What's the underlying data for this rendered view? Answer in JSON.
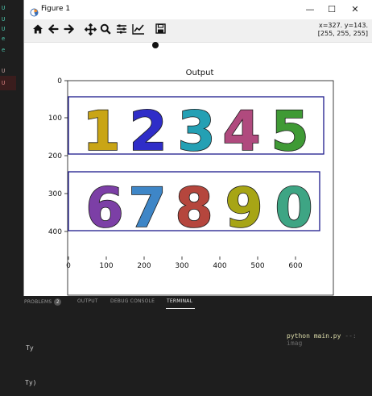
{
  "window": {
    "title": "Figure 1",
    "controls": {
      "minimize": "—",
      "maximize": "☐",
      "close": "✕"
    }
  },
  "toolbar": {
    "buttons": [
      "home-icon",
      "back-arrow-icon",
      "forward-arrow-icon",
      "pan-icon",
      "zoom-icon",
      "configure-subplots-icon",
      "edit-axis-icon",
      "save-icon"
    ],
    "coord_line1": "x=327. y=143.",
    "coord_line2": "[255, 255, 255]"
  },
  "plot": {
    "title": "Output",
    "x_ticks": [
      "0",
      "100",
      "200",
      "300",
      "400",
      "500",
      "600"
    ],
    "y_ticks": [
      "0",
      "100",
      "200",
      "300",
      "400"
    ],
    "digits_top": [
      "1",
      "2",
      "3",
      "4",
      "5"
    ],
    "digits_bottom": [
      "6",
      "7",
      "8",
      "9",
      "0"
    ],
    "digit_colors_top": [
      "#c9a515",
      "#2f2dc8",
      "#24a0b4",
      "#b04a7e",
      "#3f9a35"
    ],
    "digit_colors_bottom": [
      "#7c3fa6",
      "#3e86c7",
      "#b5463d",
      "#a7a515",
      "#3ea584"
    ],
    "box_color": "#1c1a8c"
  },
  "panel": {
    "tabs": [
      "PROBLEMS",
      "OUTPUT",
      "DEBUG CONSOLE",
      "TERMINAL"
    ],
    "problems_count": "2"
  },
  "terminal": {
    "cmd": "python main.py",
    "cmd_suffix": "--: imag",
    "line1": "Ty",
    "line2": "Ty)"
  },
  "gutter": {
    "letters": [
      "U",
      "U",
      "U",
      "e",
      "e",
      "U",
      "U"
    ]
  }
}
